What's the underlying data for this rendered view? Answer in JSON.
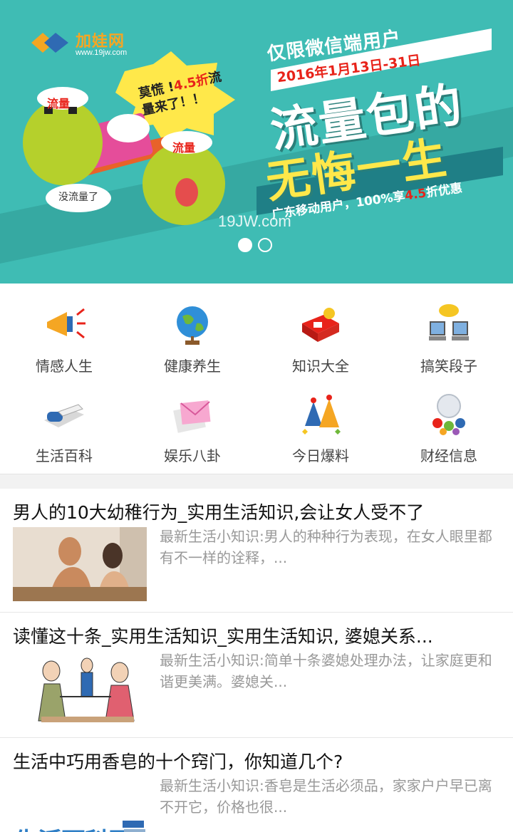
{
  "banner": {
    "logo_brand": "加娃网",
    "logo_url": "www.19jw.com",
    "bubble_prefix": "莫慌 !",
    "bubble_highlight": "4.5折",
    "bubble_suffix": "流量来了！！",
    "hat_label": "流量",
    "hat_label_2": "流量",
    "no_data_text": "没流量了",
    "subtitle": "仅限微信端用户",
    "date": "2016年1月13日-31日",
    "title_line1": "流量包的",
    "title_line2": "无悔一生",
    "strip_prefix": "广东移动用户，100%享",
    "strip_highlight": "4.5",
    "strip_suffix": "折优惠",
    "watermark": "19JW.com",
    "slide_count": 2,
    "active_slide": 0
  },
  "categories": [
    {
      "label": "情感人生",
      "icon": "megaphone-icon"
    },
    {
      "label": "健康养生",
      "icon": "globe-icon"
    },
    {
      "label": "知识大全",
      "icon": "gift-box-icon"
    },
    {
      "label": "搞笑段子",
      "icon": "chat-computers-icon"
    },
    {
      "label": "生活百科",
      "icon": "scanner-icon"
    },
    {
      "label": "娱乐八卦",
      "icon": "envelope-icon"
    },
    {
      "label": "今日爆料",
      "icon": "party-hats-icon"
    },
    {
      "label": "财经信息",
      "icon": "crystal-ball-icon"
    }
  ],
  "articles": [
    {
      "title": "男人的10大幼稚行为_实用生活知识,会让女人受不了",
      "desc": "最新生活小知识:男人的种种行为表现，在女人眼里都有不一样的诠释，...",
      "thumb": "couple-photo"
    },
    {
      "title": "读懂这十条_实用生活知识_实用生活知识, 婆媳关系...",
      "desc": "最新生活小知识:简单十条婆媳处理办法，让家庭更和谐更美满。婆媳关...",
      "thumb": "tug-of-war-cartoon"
    },
    {
      "title": "生活中巧用香皂的十个窍门，你知道几个?",
      "desc": "最新生活小知识:香皂是生活必须品，家家户户早已离不开它，价格也很...",
      "thumb": "生活百科网"
    }
  ]
}
